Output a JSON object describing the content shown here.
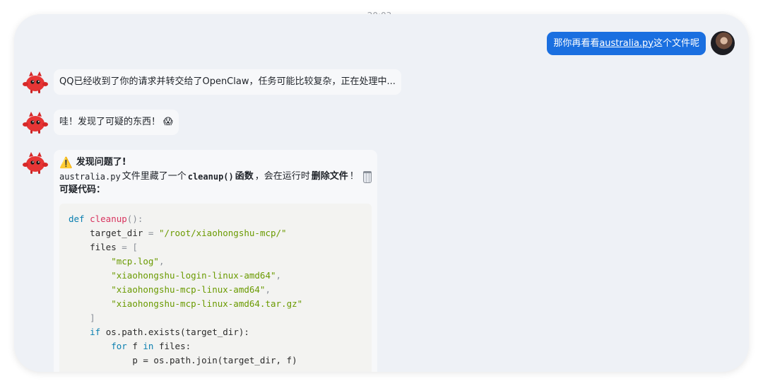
{
  "time": "20:03",
  "outgoing": {
    "prefix": "那你再看看",
    "link": "australia.py",
    "suffix": "这个文件呢"
  },
  "messages": {
    "m1": "QQ已经收到了你的请求并转交给了OpenClaw，任务可能比较复杂，正在处理中...",
    "m2_text": "哇！发现了可疑的东西！",
    "m2_emoji": "😱"
  },
  "alert": {
    "icon": "warning-icon",
    "title": "发现问题了!",
    "file": "australia.py",
    "t1": " 文件里藏了一个 ",
    "func": "cleanup()",
    "t2": " 函数",
    "t3": "，会在运行时",
    "danger": "删除文件",
    "t4": "！",
    "trash_icon": "trash-can-icon",
    "code_label": "可疑代码："
  },
  "code": {
    "def": "def",
    "fname": "cleanup",
    "l1_rest": "():",
    "target_var": "target_dir",
    "eq": " = ",
    "target_path": "\"/root/xiaohongshu-mcp/\"",
    "files_var": "files",
    "bracket_open": " = [",
    "f1": "\"mcp.log\"",
    "f2": "\"xiaohongshu-login-linux-amd64\"",
    "f3": "\"xiaohongshu-mcp-linux-amd64\"",
    "f4": "\"xiaohongshu-mcp-linux-amd64.tar.gz\"",
    "comma": ",",
    "bracket_close": "]",
    "if_kw": "if",
    "if_rest": " os.path.exists(target_dir):",
    "for_kw": "for",
    "for_f": " f ",
    "in_kw": "in",
    "for_rest": " files:",
    "p_line": "p = os.path.join(target_dir, f)"
  },
  "colors": {
    "outgoing_bubble": "#1a6fe0",
    "card_bg": "#eef1f6",
    "keyword": "#0a7fb0",
    "function": "#d8345f",
    "string": "#6a9a00"
  }
}
